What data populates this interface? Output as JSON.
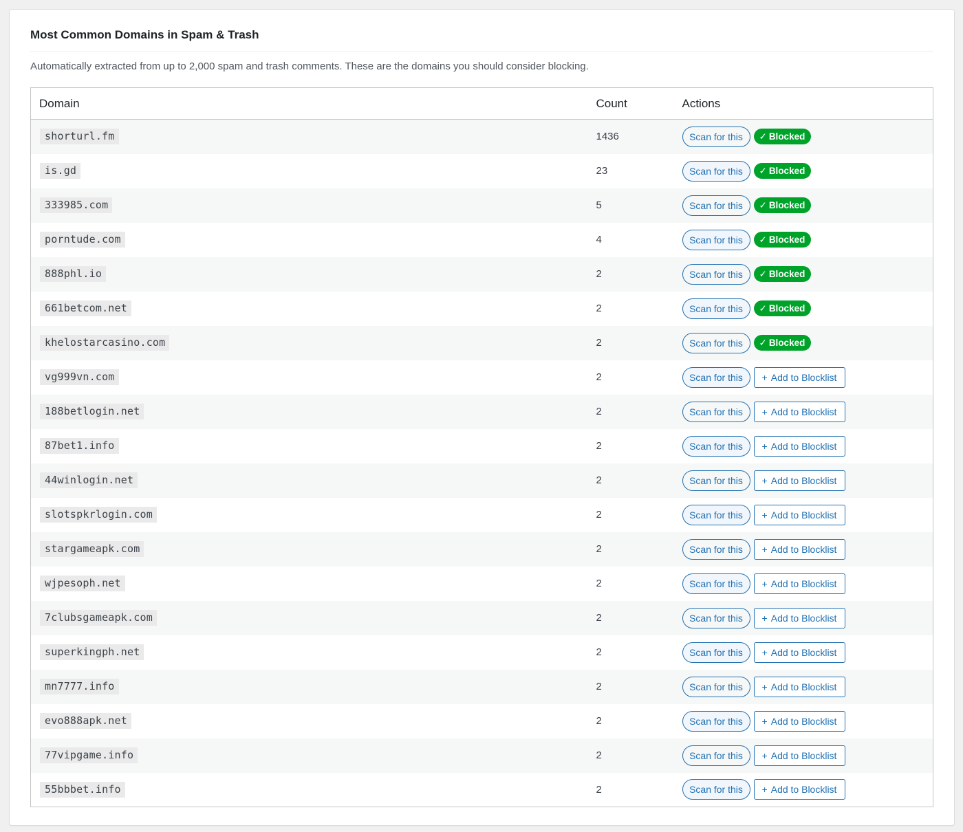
{
  "panel": {
    "title": "Most Common Domains in Spam & Trash",
    "description": "Automatically extracted from up to 2,000 spam and trash comments. These are the domains you should consider blocking."
  },
  "table": {
    "headers": {
      "domain": "Domain",
      "count": "Count",
      "actions": "Actions"
    },
    "scan_label": "Scan for this",
    "blocked_label": "Blocked",
    "add_label": "Add to Blocklist",
    "icons": {
      "check": "✓",
      "plus": "+"
    },
    "colors": {
      "accent": "#2271b1",
      "blocked_green": "#00a32a"
    },
    "rows": [
      {
        "domain": "shorturl.fm",
        "count": "1436",
        "blocked": true
      },
      {
        "domain": "is.gd",
        "count": "23",
        "blocked": true
      },
      {
        "domain": "333985.com",
        "count": "5",
        "blocked": true
      },
      {
        "domain": "porntude.com",
        "count": "4",
        "blocked": true
      },
      {
        "domain": "888phl.io",
        "count": "2",
        "blocked": true
      },
      {
        "domain": "661betcom.net",
        "count": "2",
        "blocked": true
      },
      {
        "domain": "khelostarcasino.com",
        "count": "2",
        "blocked": true
      },
      {
        "domain": "vg999vn.com",
        "count": "2",
        "blocked": false
      },
      {
        "domain": "188betlogin.net",
        "count": "2",
        "blocked": false
      },
      {
        "domain": "87bet1.info",
        "count": "2",
        "blocked": false
      },
      {
        "domain": "44winlogin.net",
        "count": "2",
        "blocked": false
      },
      {
        "domain": "slotspkrlogin.com",
        "count": "2",
        "blocked": false
      },
      {
        "domain": "stargameapk.com",
        "count": "2",
        "blocked": false
      },
      {
        "domain": "wjpesoph.net",
        "count": "2",
        "blocked": false
      },
      {
        "domain": "7clubsgameapk.com",
        "count": "2",
        "blocked": false
      },
      {
        "domain": "superkingph.net",
        "count": "2",
        "blocked": false
      },
      {
        "domain": "mn7777.info",
        "count": "2",
        "blocked": false
      },
      {
        "domain": "evo888apk.net",
        "count": "2",
        "blocked": false
      },
      {
        "domain": "77vipgame.info",
        "count": "2",
        "blocked": false
      },
      {
        "domain": "55bbbet.info",
        "count": "2",
        "blocked": false
      }
    ]
  }
}
